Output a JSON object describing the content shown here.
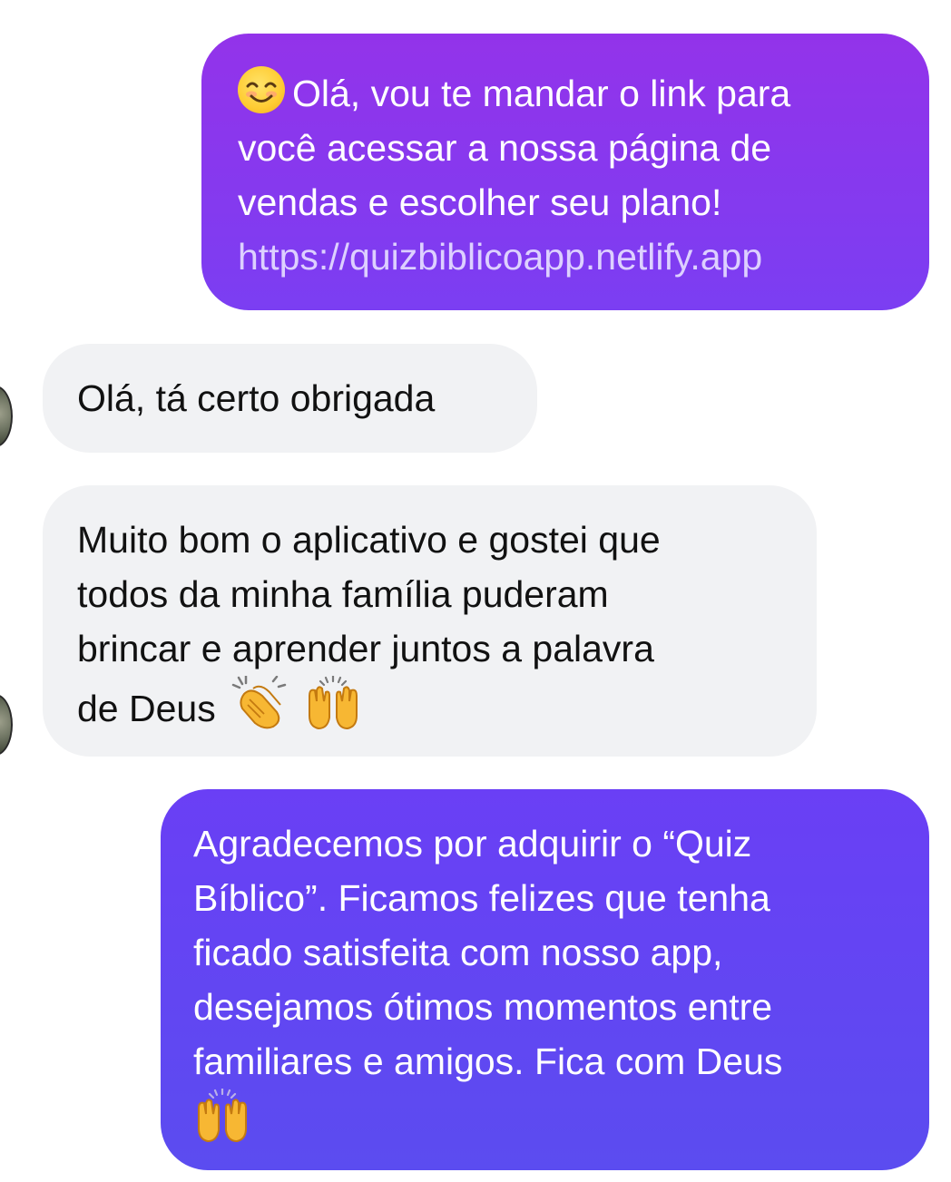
{
  "messages": [
    {
      "direction": "outgoing",
      "emoji_prefix": "smiling-face-icon",
      "lines": [
        "Olá, vou te mandar o link para",
        "você acessar a nossa página de",
        "vendas e escolher seu plano!"
      ],
      "link": "https://quizbiblicoapp.netlify.app"
    },
    {
      "direction": "incoming",
      "lines": [
        "Olá, tá certo obrigada"
      ]
    },
    {
      "direction": "incoming",
      "lines": [
        "Muito bom o aplicativo e gostei que",
        "todos da minha família puderam",
        "brincar e aprender juntos a palavra",
        "de Deus"
      ],
      "emoji_suffix": [
        "clapping-hands-icon",
        "raising-hands-icon"
      ]
    },
    {
      "direction": "outgoing",
      "lines": [
        "Agradecemos por adquirir o “Quiz",
        "Bíblico”. Ficamos felizes que tenha",
        "ficado satisfeita com nosso app,",
        "desejamos ótimos momentos entre",
        "familiares e amigos. Fica com Deus"
      ],
      "emoji_suffix": [
        "raising-hands-icon"
      ]
    }
  ],
  "colors": {
    "outgoing_top": "#9333ea",
    "outgoing_bottom": "#5b4cf0",
    "incoming_bg": "#f1f2f4",
    "link": "#ddd0ff"
  }
}
